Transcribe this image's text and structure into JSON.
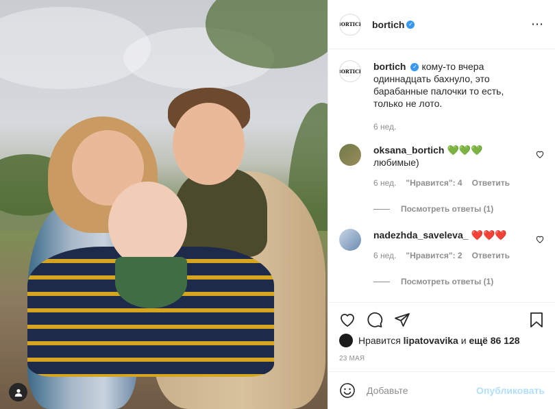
{
  "post": {
    "author": "bortich",
    "author_verified": true,
    "avatar_label": "BORTICH"
  },
  "header": {
    "username": "bortich",
    "more_icon": "⋯"
  },
  "caption": {
    "username": "bortich",
    "text": "кому-то вчера одиннадцать бахнуло, это барабанные палочки то есть, только не лото.",
    "time": "6 нед."
  },
  "comments": [
    {
      "username": "oksana_bortich",
      "text": "💚💚💚 любимые)",
      "time": "6 нед.",
      "likes": "\"Нравится\": 4",
      "reply": "Ответить",
      "view_replies": "Посмотреть ответы (1)"
    },
    {
      "username": "nadezhda_saveleva_",
      "text": "❤️❤️❤️",
      "time": "6 нед.",
      "likes": "\"Нравится\": 2",
      "reply": "Ответить",
      "view_replies": "Посмотреть ответы (1)"
    }
  ],
  "likes_row": {
    "prefix": "Нравится",
    "user": "lipatovavika",
    "middle": "и",
    "count": "ещё 86 128"
  },
  "date": "23 МАЯ",
  "add_comment": {
    "placeholder": "Добавьте",
    "post_label": "Опубликовать"
  },
  "colors": {
    "verified": "#3897f0",
    "post_disabled": "#b2dffc",
    "meta": "#8e8e8e"
  }
}
